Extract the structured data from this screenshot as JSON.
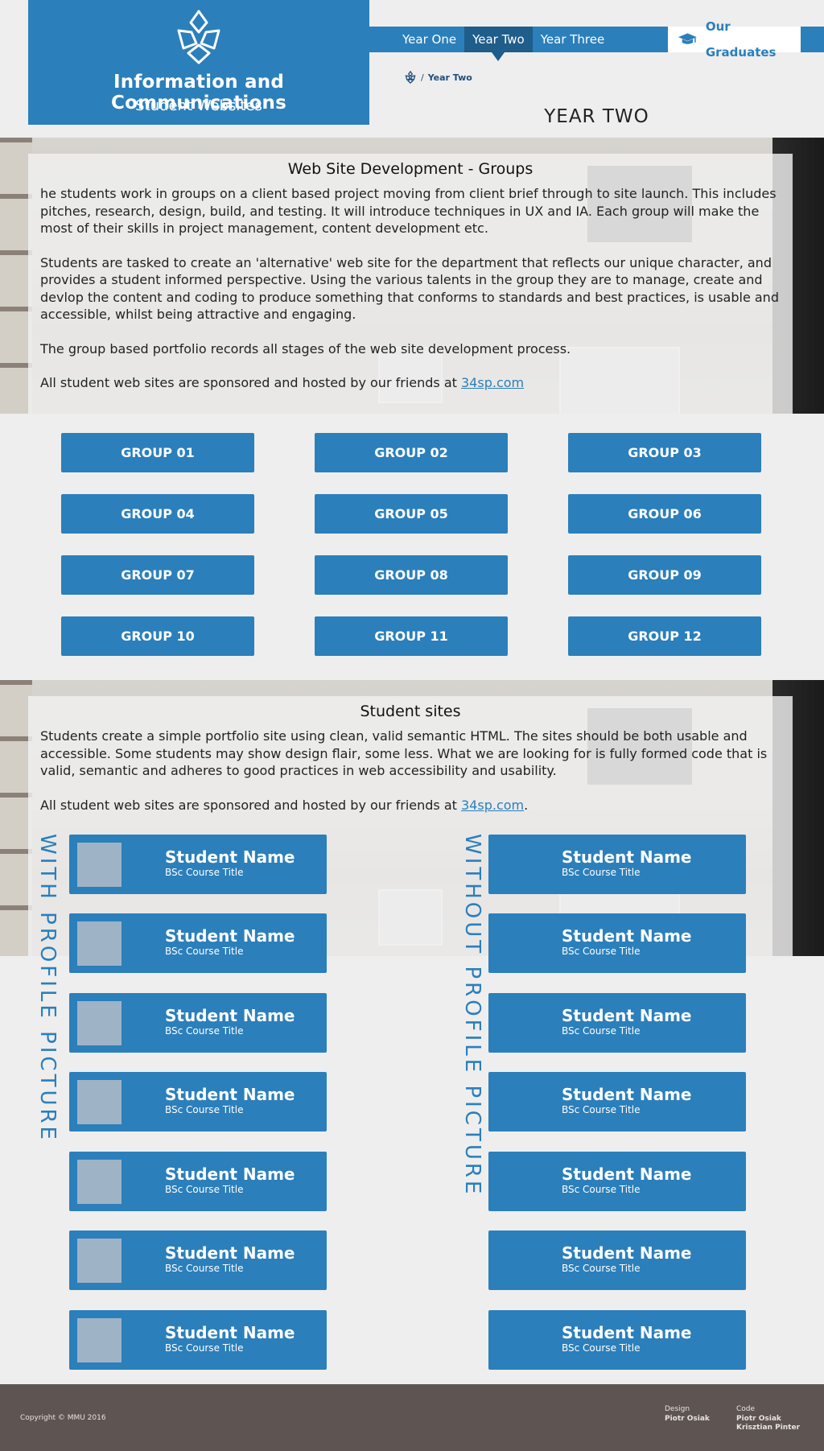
{
  "header": {
    "title": "Information and Communications",
    "subtitle": "Student Websites",
    "logo_icon": "trefoil-logo-icon"
  },
  "nav": {
    "items": [
      {
        "label": "Year One",
        "active": false
      },
      {
        "label": "Year Two",
        "active": true
      },
      {
        "label": "Year Three",
        "active": false
      }
    ],
    "graduates_label": "Our Graduates",
    "graduates_icon": "graduation-cap-icon"
  },
  "breadcrumb": {
    "home_icon": "trefoil-home-icon",
    "separator": "/",
    "current": "Year Two"
  },
  "page_title": "YEAR TWO",
  "groups_section": {
    "heading": "Web Site Development - Groups",
    "paragraphs": [
      "he students work in groups on a client based project moving from client brief through to site launch. This includes pitches, research, design, build, and testing. It will introduce techniques in UX and IA. Each group will make the most of their skills in project management, content development etc.",
      "Students are tasked to create an 'alternative' web site for the department that reflects our unique character, and provides a student informed perspective. Using the various talents in the group they are to manage, create and devlop the content and coding to produce something that conforms to standards and best practices, is usable and accessible, whilst being attractive and engaging.",
      "The group based portfolio records all stages of the web site development process."
    ],
    "sponsor_text": "All student web sites are sponsored and hosted by our friends at",
    "sponsor_link": "34sp.com"
  },
  "groups": [
    "GROUP 01",
    "GROUP 02",
    "GROUP 03",
    "GROUP 04",
    "GROUP 05",
    "GROUP 06",
    "GROUP 07",
    "GROUP 08",
    "GROUP 09",
    "GROUP 10",
    "GROUP 11",
    "GROUP 12"
  ],
  "students_section": {
    "heading": "Student sites",
    "paragraph": "Students create a simple portfolio site using clean, valid semantic HTML. The sites should be both usable and accessible. Some students may show design flair, some less. What we are looking for is fully formed code that is valid, semantic and adheres to good practices in web accessibility and usability.",
    "sponsor_text": "All student web sites are sponsored and hosted by our friends at",
    "sponsor_link": "34sp.com",
    "sponsor_suffix": "."
  },
  "with_picture": {
    "label": "WITH PROFILE PICTURE",
    "cards": [
      {
        "name": "Student Name",
        "course": "BSc Course Title"
      },
      {
        "name": "Student Name",
        "course": "BSc Course Title"
      },
      {
        "name": "Student Name",
        "course": "BSc Course Title"
      },
      {
        "name": "Student Name",
        "course": "BSc Course Title"
      },
      {
        "name": "Student Name",
        "course": "BSc Course Title"
      },
      {
        "name": "Student Name",
        "course": "BSc Course Title"
      },
      {
        "name": "Student Name",
        "course": "BSc Course Title"
      }
    ]
  },
  "without_picture": {
    "label": "WITHOUT PROFILE PICTURE",
    "cards": [
      {
        "name": "Student Name",
        "course": "BSc Course Title"
      },
      {
        "name": "Student Name",
        "course": "BSc Course Title"
      },
      {
        "name": "Student Name",
        "course": "BSc Course Title"
      },
      {
        "name": "Student Name",
        "course": "BSc Course Title"
      },
      {
        "name": "Student Name",
        "course": "BSc Course Title"
      },
      {
        "name": "Student Name",
        "course": "BSc Course Title"
      },
      {
        "name": "Student Name",
        "course": "BSc Course Title"
      }
    ]
  },
  "footer": {
    "copyright": "Copyright © MMU 2016",
    "design_label": "Design",
    "design_names": [
      "Piotr Osiak"
    ],
    "code_label": "Code",
    "code_names": [
      "Piotr Osiak",
      "Krisztian Pinter"
    ]
  },
  "colors": {
    "accent": "#2b7fbb",
    "accent_dark": "#1f5d8a",
    "footer": "#5e5451",
    "page_bg": "#eeeeee"
  }
}
